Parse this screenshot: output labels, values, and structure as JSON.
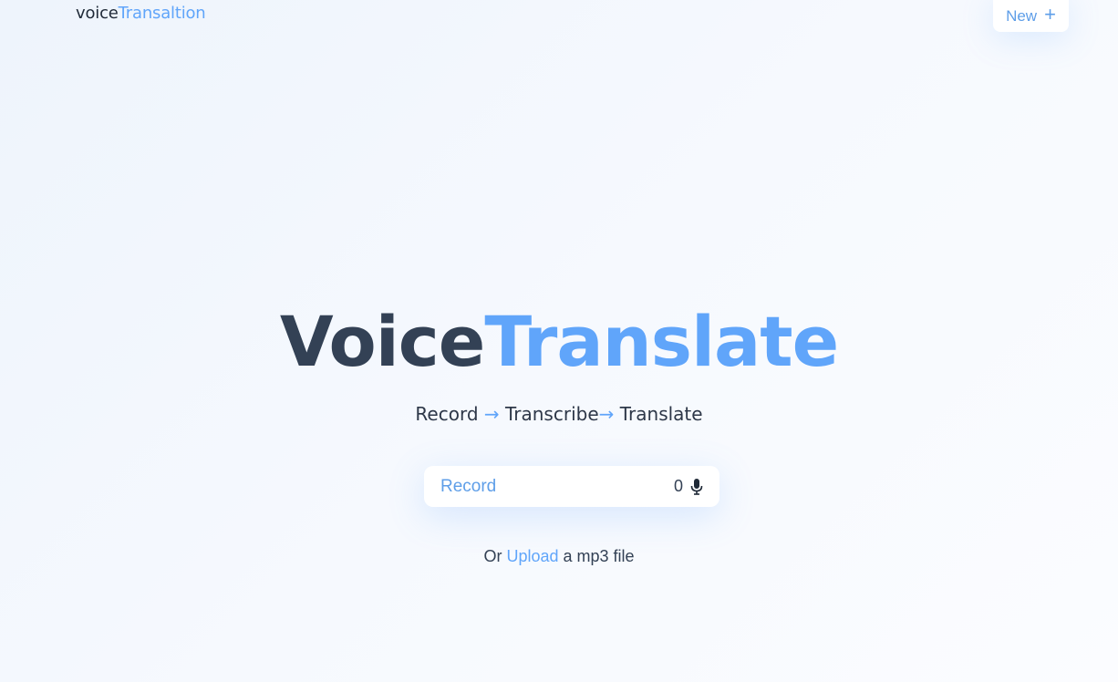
{
  "header": {
    "logo_prefix": "voice",
    "logo_suffix": "Transaltion",
    "new_button_label": "New",
    "new_button_icon": "plus-icon"
  },
  "hero": {
    "title_prefix": "Voice",
    "title_suffix": "Translate",
    "steps": [
      "Record",
      "Transcribe",
      "Translate"
    ],
    "arrow": "→"
  },
  "recorder": {
    "label": "Record",
    "count": "0",
    "icon": "microphone-icon"
  },
  "upload": {
    "prefix": "Or",
    "link_label": "Upload",
    "suffix": "a mp3 file"
  },
  "colors": {
    "accent": "#60a5fa",
    "dark_text": "#334155",
    "background": "#f4f8fd"
  }
}
